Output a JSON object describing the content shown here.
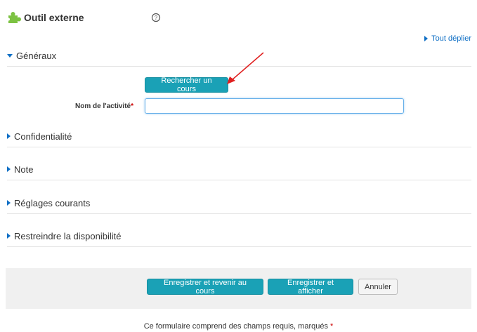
{
  "header": {
    "title": "Outil externe",
    "help_icon": "question-circle-icon",
    "module_icon": "puzzle-piece-icon"
  },
  "expand_all": "Tout déplier",
  "sections": {
    "generaux": "Généraux",
    "confidentialite": "Confidentialité",
    "note": "Note",
    "reglages": "Réglages courants",
    "restreindre": "Restreindre la disponibilité"
  },
  "general": {
    "search_button": "Rechercher un cours",
    "activity_name_label": "Nom de l'activité",
    "required_mark": "*",
    "activity_name_value": ""
  },
  "actions": {
    "save_return": "Enregistrer et revenir au cours",
    "save_display": "Enregistrer et afficher",
    "cancel": "Annuler"
  },
  "footer": {
    "note": "Ce formulaire comprend des champs requis, marqués",
    "required_mark": "*"
  },
  "colors": {
    "accent": "#1aa1b6",
    "link": "#0f6fc5",
    "required": "#cc0000",
    "annotation_arrow": "#e02020"
  }
}
